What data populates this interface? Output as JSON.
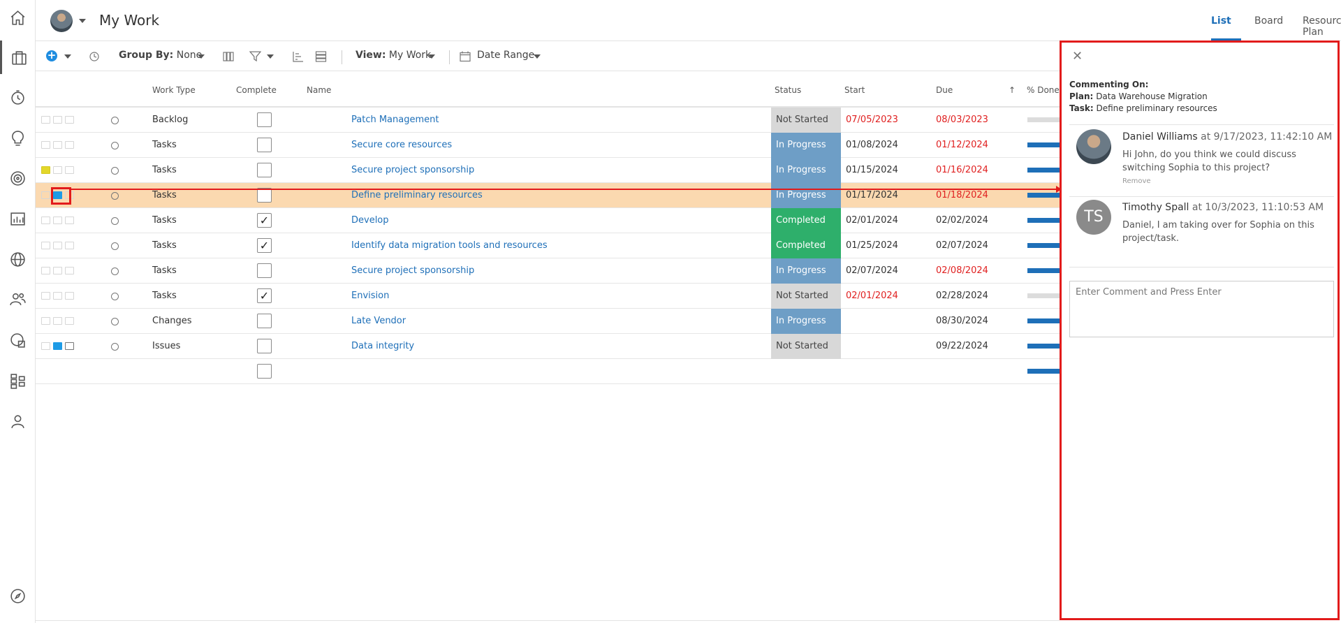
{
  "app": {
    "page_title": "My Work",
    "tabs": [
      {
        "label": "List",
        "active": true
      },
      {
        "label": "Board",
        "active": false
      },
      {
        "label": "Resource Plan",
        "active": false
      }
    ],
    "accent_color": "#1e6fb8"
  },
  "rail": {
    "items": [
      "home-icon",
      "briefcase-icon",
      "timer-icon",
      "lightbulb-icon",
      "target-icon",
      "report-icon",
      "globe-icon",
      "people-icon",
      "portfolio-icon",
      "hierarchy-icon",
      "person-icon",
      "compass-icon"
    ]
  },
  "toolbar": {
    "group_by_label": "Group By:",
    "group_by_value": "None",
    "view_label": "View:",
    "view_value": "My Work",
    "date_range_label": "Date Range"
  },
  "grid": {
    "columns": {
      "work_type": "Work Type",
      "complete": "Complete",
      "name": "Name",
      "status": "Status",
      "start": "Start",
      "due": "Due",
      "pct_done": "% Done"
    },
    "rows": [
      {
        "work_type": "Backlog",
        "complete": false,
        "name": "Patch Management",
        "status": "Not Started",
        "start": "07/05/2023",
        "due": "08/03/2023",
        "start_overdue": true,
        "due_overdue": true,
        "done": "empty"
      },
      {
        "work_type": "Tasks",
        "complete": false,
        "name": "Secure core resources",
        "status": "In Progress",
        "start": "01/08/2024",
        "due": "01/12/2024",
        "start_overdue": false,
        "due_overdue": true,
        "done": "full"
      },
      {
        "work_type": "Tasks",
        "complete": false,
        "name": "Secure project sponsorship",
        "status": "In Progress",
        "start": "01/15/2024",
        "due": "01/16/2024",
        "start_overdue": false,
        "due_overdue": true,
        "done": "full"
      },
      {
        "work_type": "Tasks",
        "complete": false,
        "name": "Define preliminary resources",
        "status": "In Progress",
        "start": "01/17/2024",
        "due": "01/18/2024",
        "start_overdue": false,
        "due_overdue": true,
        "done": "full"
      },
      {
        "work_type": "Tasks",
        "complete": true,
        "name": "Develop",
        "status": "Completed",
        "start": "02/01/2024",
        "due": "02/02/2024",
        "start_overdue": false,
        "due_overdue": false,
        "done": "full"
      },
      {
        "work_type": "Tasks",
        "complete": true,
        "name": "Identify data migration tools and resources",
        "status": "Completed",
        "start": "01/25/2024",
        "due": "02/07/2024",
        "start_overdue": false,
        "due_overdue": false,
        "done": "full"
      },
      {
        "work_type": "Tasks",
        "complete": false,
        "name": "Secure project sponsorship",
        "status": "In Progress",
        "start": "02/07/2024",
        "due": "02/08/2024",
        "start_overdue": false,
        "due_overdue": true,
        "done": "full"
      },
      {
        "work_type": "Tasks",
        "complete": true,
        "name": "Envision",
        "status": "Not Started",
        "start": "02/01/2024",
        "due": "02/28/2024",
        "start_overdue": true,
        "due_overdue": false,
        "done": "empty"
      },
      {
        "work_type": "Changes",
        "complete": false,
        "name": "Late Vendor",
        "status": "In Progress",
        "start": "",
        "due": "08/30/2024",
        "start_overdue": false,
        "due_overdue": false,
        "done": "full"
      },
      {
        "work_type": "Issues",
        "complete": false,
        "name": "Data integrity",
        "status": "Not Started",
        "start": "",
        "due": "09/22/2024",
        "start_overdue": false,
        "due_overdue": false,
        "done": "full"
      },
      {
        "work_type": "",
        "complete": false,
        "name": "",
        "status": "",
        "start": "",
        "due": "",
        "start_overdue": false,
        "due_overdue": false,
        "done": "full"
      }
    ]
  },
  "comments": {
    "commenting_on_label": "Commenting On:",
    "plan_label": "Plan:",
    "plan_value": "Data Warehouse Migration",
    "task_label": "Task:",
    "task_value": "Define preliminary resources",
    "items": [
      {
        "author": "Daniel Williams",
        "when": "at 9/17/2023, 11:42:10 AM",
        "text": "Hi John, do you think we could discuss switching Sophia to this project?",
        "remove_label": "Remove",
        "avatar_initials": ""
      },
      {
        "author": "Timothy Spall",
        "when": "at 10/3/2023, 11:10:53 AM",
        "text": "Daniel, I am taking over for Sophia on this project/task.",
        "remove_label": "",
        "avatar_initials": "TS"
      }
    ],
    "input_placeholder": "Enter Comment and Press Enter"
  }
}
